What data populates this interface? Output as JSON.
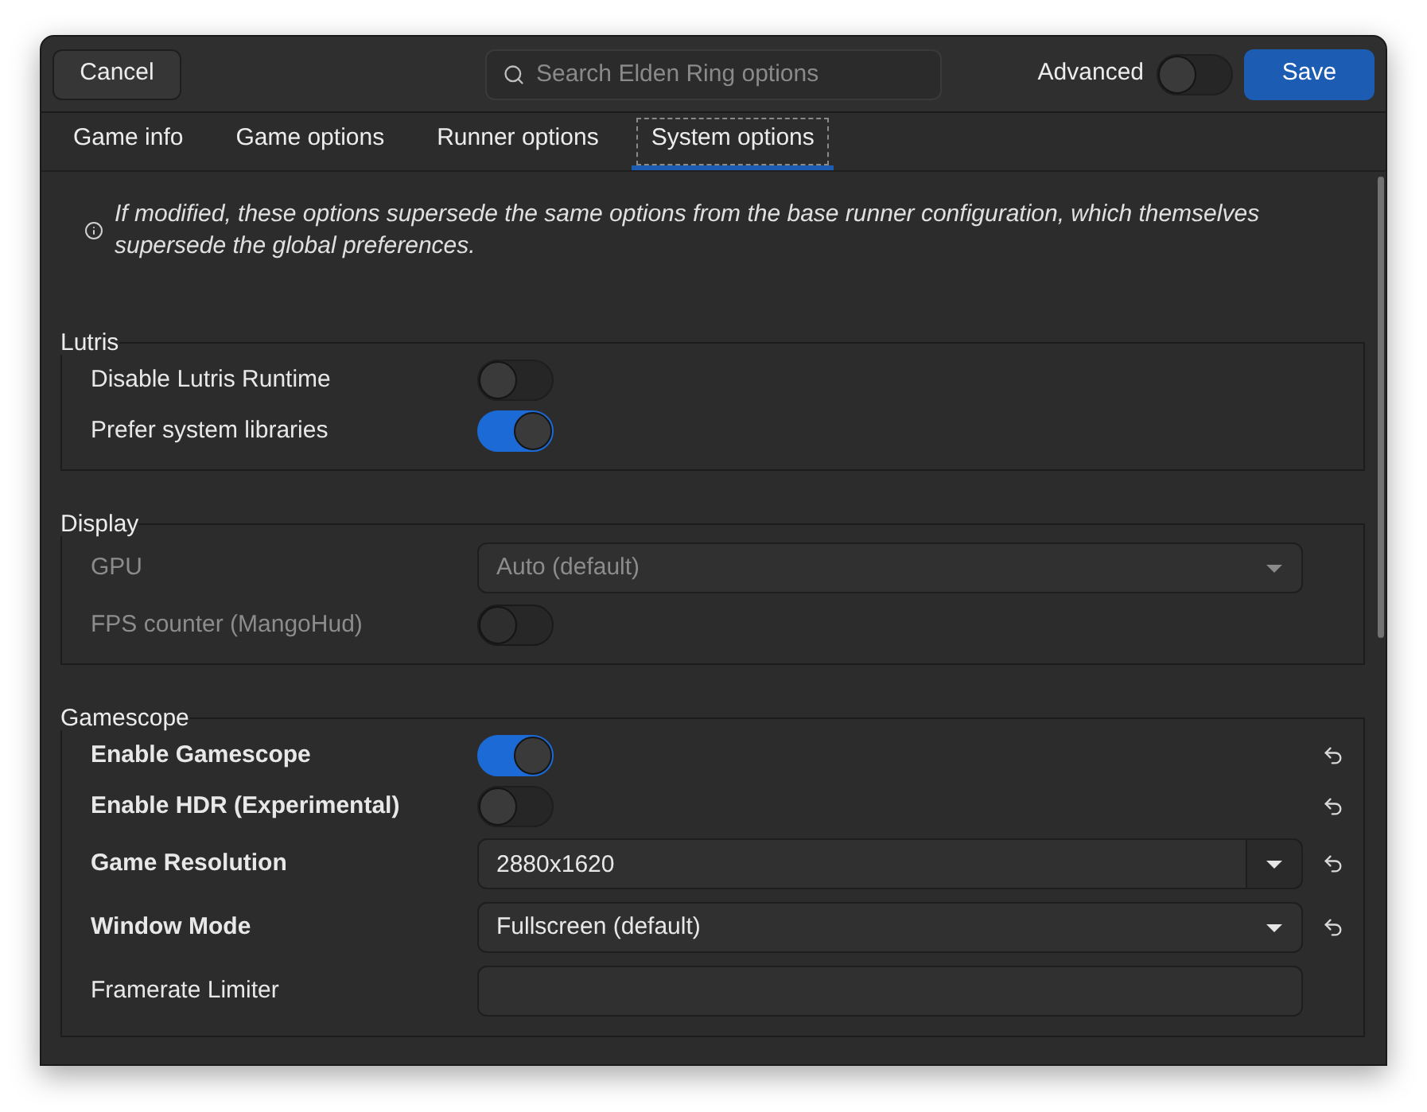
{
  "header": {
    "cancel_label": "Cancel",
    "search": {
      "placeholder": "Search Elden Ring options"
    },
    "advanced": {
      "label": "Advanced",
      "on": false
    },
    "save_label": "Save"
  },
  "tabs": [
    {
      "label": "Game info",
      "selected": false
    },
    {
      "label": "Game options",
      "selected": false
    },
    {
      "label": "Runner options",
      "selected": false
    },
    {
      "label": "System options",
      "selected": true
    }
  ],
  "notice": "If modified, these options supersede the same options from the base runner configuration, which themselves supersede the global preferences.",
  "sections": [
    {
      "title": "Lutris",
      "items": [
        {
          "kind": "switch",
          "label": "Disable Lutris Runtime",
          "on": false,
          "disabled": false,
          "modified": false
        },
        {
          "kind": "switch",
          "label": "Prefer system libraries",
          "on": true,
          "disabled": false,
          "modified": false
        }
      ]
    },
    {
      "title": "Display",
      "items": [
        {
          "kind": "dropdown",
          "label": "GPU",
          "value": "Auto (default)",
          "disabled": true,
          "modified": false
        },
        {
          "kind": "switch",
          "label": "FPS counter (MangoHud)",
          "on": false,
          "disabled": true,
          "modified": false
        }
      ]
    },
    {
      "title": "Gamescope",
      "items": [
        {
          "kind": "switch",
          "label": "Enable Gamescope",
          "on": true,
          "disabled": false,
          "modified": true
        },
        {
          "kind": "switch",
          "label": "Enable HDR (Experimental)",
          "on": false,
          "disabled": false,
          "modified": true
        },
        {
          "kind": "combo",
          "label": "Game Resolution",
          "value": "2880x1620",
          "disabled": false,
          "modified": true
        },
        {
          "kind": "dropdown",
          "label": "Window Mode",
          "value": "Fullscreen (default)",
          "disabled": false,
          "modified": true
        },
        {
          "kind": "entry",
          "label": "Framerate Limiter",
          "disabled": false,
          "modified": false
        }
      ]
    }
  ]
}
